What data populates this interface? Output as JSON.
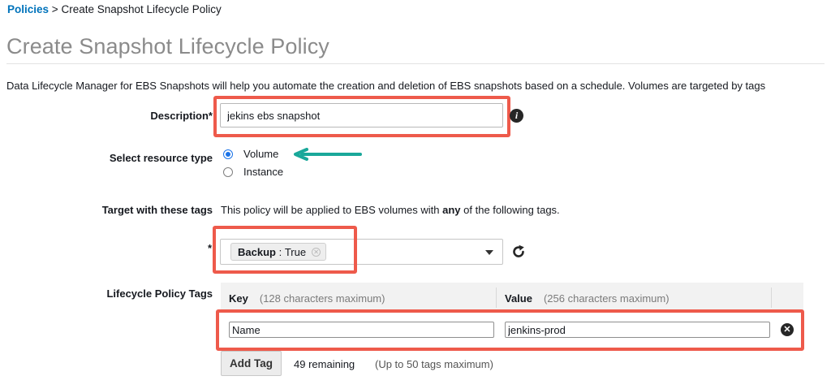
{
  "breadcrumb": {
    "link": "Policies",
    "separator": ">",
    "current": "Create Snapshot Lifecycle Policy"
  },
  "page": {
    "title": "Create Snapshot Lifecycle Policy",
    "intro": "Data Lifecycle Manager for EBS Snapshots will help you automate the creation and deletion of EBS snapshots based on a schedule. Volumes are targeted by tags"
  },
  "description": {
    "label": "Description*",
    "value": "jekins ebs snapshot",
    "info_icon": "info-icon"
  },
  "resource_type": {
    "label": "Select resource type",
    "options": [
      {
        "label": "Volume",
        "selected": true
      },
      {
        "label": "Instance",
        "selected": false
      }
    ]
  },
  "target_tags": {
    "label": "Target with these tags",
    "help_pre": "This policy will be applied to EBS volumes with ",
    "help_bold": "any",
    "help_post": " of the following tags.",
    "required_mark": "*",
    "token": {
      "key": "Backup",
      "separator": " : ",
      "value": "True"
    },
    "refresh_icon": "refresh-icon",
    "dropdown_icon": "caret-down-icon"
  },
  "lifecycle_tags": {
    "label": "Lifecycle Policy Tags",
    "columns": [
      {
        "title": "Key",
        "hint": "(128 characters maximum)"
      },
      {
        "title": "Value",
        "hint": "(256 characters maximum)"
      }
    ],
    "rows": [
      {
        "key": "Name",
        "value": "jenkins-prod"
      }
    ],
    "add_button": "Add Tag",
    "remaining": "49 remaining",
    "max_note": "(Up to 50 tags maximum)"
  },
  "annotation": {
    "arrow_color": "#1aa89a",
    "highlight_color": "#ee5a4b"
  }
}
